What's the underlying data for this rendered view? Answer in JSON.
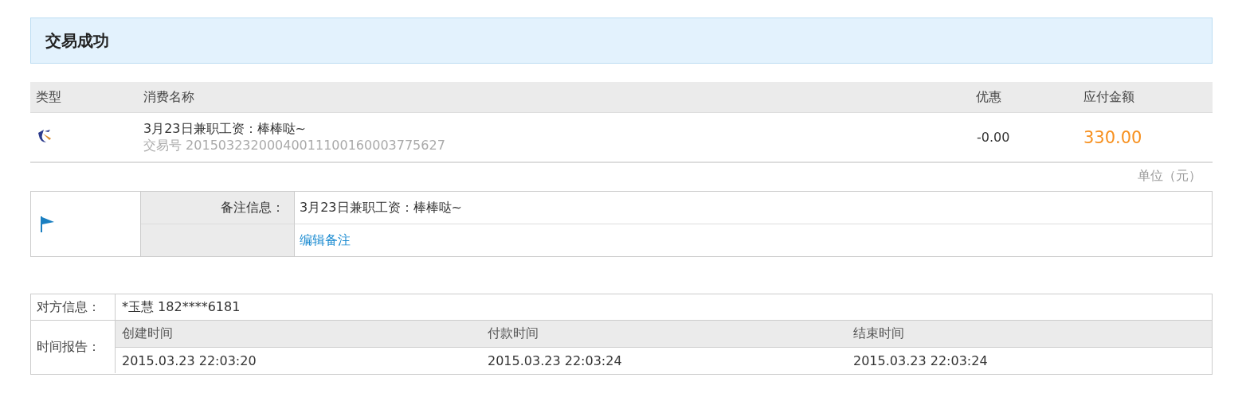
{
  "status": {
    "title": "交易成功"
  },
  "table": {
    "columns": [
      "类型",
      "消费名称",
      "优惠",
      "应付金额"
    ],
    "rows": [
      {
        "name": "3月23日兼职工资：棒棒哒~",
        "serial_label": "交易号",
        "serial": "20150323200040011100160003775627",
        "discount": "-0.00",
        "amount": "330.00"
      }
    ]
  },
  "unit": "单位（元）",
  "memo": {
    "label": "备注信息：",
    "text": "3月23日兼职工资：棒棒哒~",
    "edit_link": "编辑备注"
  },
  "party": {
    "label": "对方信息：",
    "value": "*玉慧 182****6181"
  },
  "time_report": {
    "label": "时间报告：",
    "columns": [
      "创建时间",
      "付款时间",
      "结束时间"
    ],
    "values": [
      "2015.03.23 22:03:20",
      "2015.03.23 22:03:24",
      "2015.03.23 22:03:24"
    ]
  }
}
